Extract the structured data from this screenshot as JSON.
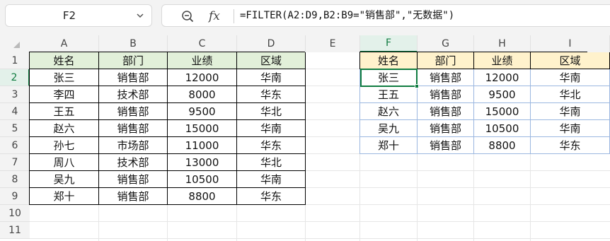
{
  "name_box": {
    "value": "F2"
  },
  "formula_bar": {
    "fx_label": "fx",
    "formula": "=FILTER(A2:D9,B2:B9=\"销售部\",\"无数据\")"
  },
  "columns": [
    "A",
    "B",
    "C",
    "D",
    "E",
    "F",
    "G",
    "H",
    "I"
  ],
  "rows": [
    "1",
    "2",
    "3",
    "4",
    "5",
    "6",
    "7",
    "8",
    "9",
    "10",
    "11"
  ],
  "source_table": {
    "headers": [
      "姓名",
      "部门",
      "业绩",
      "区域"
    ],
    "rows": [
      [
        "张三",
        "销售部",
        "12000",
        "华南"
      ],
      [
        "李四",
        "技术部",
        "8000",
        "华东"
      ],
      [
        "王五",
        "销售部",
        "9500",
        "华北"
      ],
      [
        "赵六",
        "销售部",
        "15000",
        "华南"
      ],
      [
        "孙七",
        "市场部",
        "11000",
        "华东"
      ],
      [
        "周八",
        "技术部",
        "13000",
        "华北"
      ],
      [
        "吴九",
        "销售部",
        "10500",
        "华南"
      ],
      [
        "郑十",
        "销售部",
        "8800",
        "华东"
      ]
    ]
  },
  "result_table": {
    "headers": [
      "姓名",
      "部门",
      "业绩",
      "区域"
    ],
    "rows": [
      [
        "张三",
        "销售部",
        "12000",
        "华南"
      ],
      [
        "王五",
        "销售部",
        "9500",
        "华北"
      ],
      [
        "赵六",
        "销售部",
        "15000",
        "华南"
      ],
      [
        "吴九",
        "销售部",
        "10500",
        "华南"
      ],
      [
        "郑十",
        "销售部",
        "8800",
        "华东"
      ]
    ]
  },
  "colors": {
    "header_green": "#e2f0d9",
    "header_yellow": "#fff2cc",
    "selection_green": "#107c41",
    "spill_border_blue": "#9bb7e0"
  },
  "icons": {
    "name_box_dropdown": "chevron-down-icon",
    "zoom": "zoom-icon"
  }
}
